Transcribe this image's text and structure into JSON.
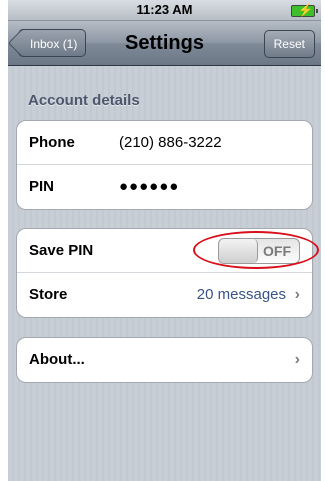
{
  "status_bar": {
    "time": "11:23 AM"
  },
  "nav": {
    "back_label": "Inbox (1)",
    "title": "Settings",
    "reset_label": "Reset"
  },
  "account": {
    "header": "Account details",
    "phone_label": "Phone",
    "phone_value": "(210) 886-3222",
    "pin_label": "PIN",
    "pin_value": "●●●●●●"
  },
  "prefs": {
    "save_pin_label": "Save PIN",
    "save_pin_state": "OFF",
    "store_label": "Store",
    "store_value": "20 messages"
  },
  "about": {
    "label": "About..."
  },
  "colors": {
    "detail": "#385487",
    "annotation": "#d8101c"
  }
}
